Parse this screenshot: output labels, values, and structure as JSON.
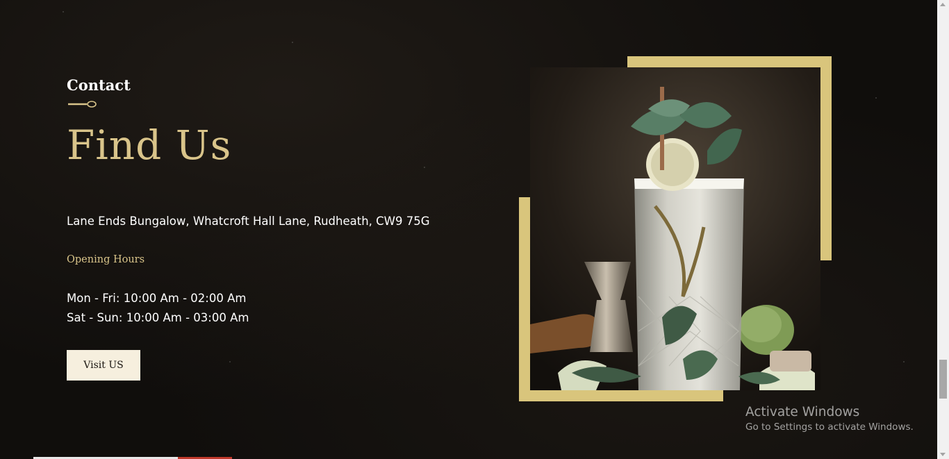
{
  "contact": {
    "section_label": "Contact",
    "heading": "Find Us",
    "address": "Lane Ends Bungalow, Whatcroft Hall Lane, Rudheath, CW9 75G",
    "hours_title": "Opening Hours",
    "hours": [
      "Mon - Fri: 10:00 Am - 02:00 Am",
      "Sat - Sun: 10:00 Am - 03:00 Am"
    ],
    "visit_button": "Visit US"
  },
  "windows_notice": {
    "title": "Activate Windows",
    "subtitle": "Go to Settings to activate Windows."
  },
  "colors": {
    "accent_gold": "#d9c48a",
    "frame_gold": "#d9c57c",
    "background": "#100e0c",
    "button_bg": "#f6efde"
  },
  "icons": {
    "divider": "spoon-icon",
    "photo": "cocktail-photo"
  }
}
